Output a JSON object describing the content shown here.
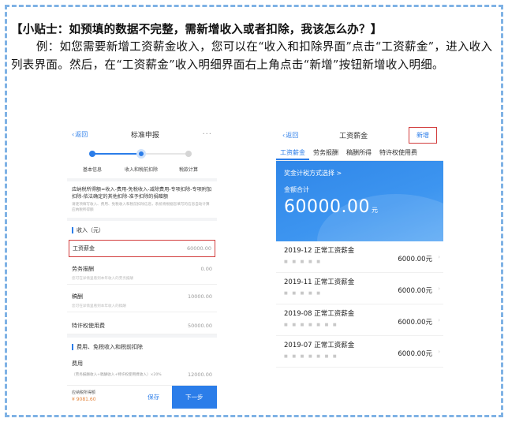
{
  "tip": {
    "title": "【小贴士：如预填的数据不完整，需新增收入或者扣除，我该怎么办？】",
    "body": "例：如您需要新增工资薪金收入，您可以在“收入和扣除界面”点击“工资薪金”，进入收入列表界面。然后，在“工资薪金”收入明细界面右上角点击“新增”按钮新增收入明细。"
  },
  "left_phone": {
    "back_label": "返回",
    "title": "标准申报",
    "more": "···",
    "steps": [
      "基本信息",
      "收入和税前扣除",
      "税款计算"
    ],
    "formula": "应纳税所得额=收入-费用-免税收入-减除费用-专项扣除-专项附加扣除-依法确定的其他扣除-准予扣除的捐赠额",
    "note": "请逐项填写收入、费用、免税收入和税前扣除信息，系统将根据您填写的信息自动计算应纳税所得额",
    "income_section": "收入（元）",
    "income_rows": [
      {
        "label": "工资薪金",
        "value": "60000.00"
      },
      {
        "label": "劳务报酬",
        "value": "0.00",
        "note": "您可在详情里看到本年收入的劳务报酬"
      },
      {
        "label": "稿酬",
        "value": "10000.00",
        "note": "您可在详情里看到本年收入的稿酬"
      },
      {
        "label": "特许权使用费",
        "value": "50000.00"
      }
    ],
    "expense_section": "费用、免税收入和税前扣除",
    "expense_label": "费用",
    "expense_value": "12000.00",
    "expense_sub": "（劳务报酬收入+稿酬收入+特许权使用费收入）×20%",
    "bottom": {
      "taxable_label": "应纳税所得额",
      "taxable_amount": "¥ 9081.60",
      "save": "保存",
      "next": "下一步"
    }
  },
  "right_phone": {
    "back_label": "返回",
    "title": "工资薪金",
    "new_button": "新增",
    "tabs": [
      "工资薪金",
      "劳务报酬",
      "稿酬所得",
      "特许权使用费"
    ],
    "method_link": "奖金计税方式选择 >",
    "total_label": "金额合计",
    "total_value": "60000.00",
    "total_unit": "元",
    "items": [
      {
        "title": "2019-12 正常工资薪金",
        "amount": "6000.00元"
      },
      {
        "title": "2019-11 正常工资薪金",
        "amount": "6000.00元"
      },
      {
        "title": "2019-08 正常工资薪金",
        "amount": "6000.00元"
      },
      {
        "title": "2019-07 正常工资薪金",
        "amount": "6000.00元"
      }
    ]
  },
  "colors": {
    "accent": "#2b7de9",
    "highlight_box": "#d23c3c",
    "frame_border": "#7fb2e5",
    "amount_orange": "#e3843b"
  }
}
